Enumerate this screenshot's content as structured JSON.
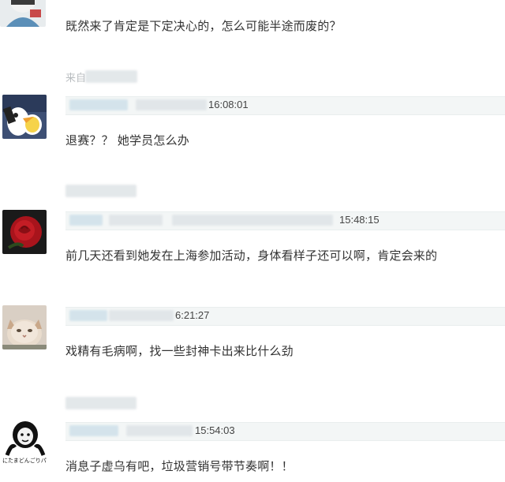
{
  "comments": [
    {
      "time": "",
      "text": "既然来了肯定是下定决心的，怎么可能半途而废的？"
    },
    {
      "time": "16:08:01",
      "text": "退赛？？ 她学员怎么办"
    },
    {
      "time": "15:48:15",
      "text": "前几天还看到她发在上海参加活动，身体看样子还可以啊，肯定会来的"
    },
    {
      "time": "6:21:27",
      "text": "戏精有毛病啊，找一些封神卡出来比什么劲"
    },
    {
      "time": "15:54:03",
      "text": "消息子虚乌有吧，垃圾营销号带节奏啊！！"
    }
  ],
  "source_prefix": "来自",
  "avatar_caption": "にたまどんごりパ",
  "colors": {
    "meta_bg": "#f3f6f6",
    "text": "#333333",
    "blur": "#dfe4e7"
  }
}
